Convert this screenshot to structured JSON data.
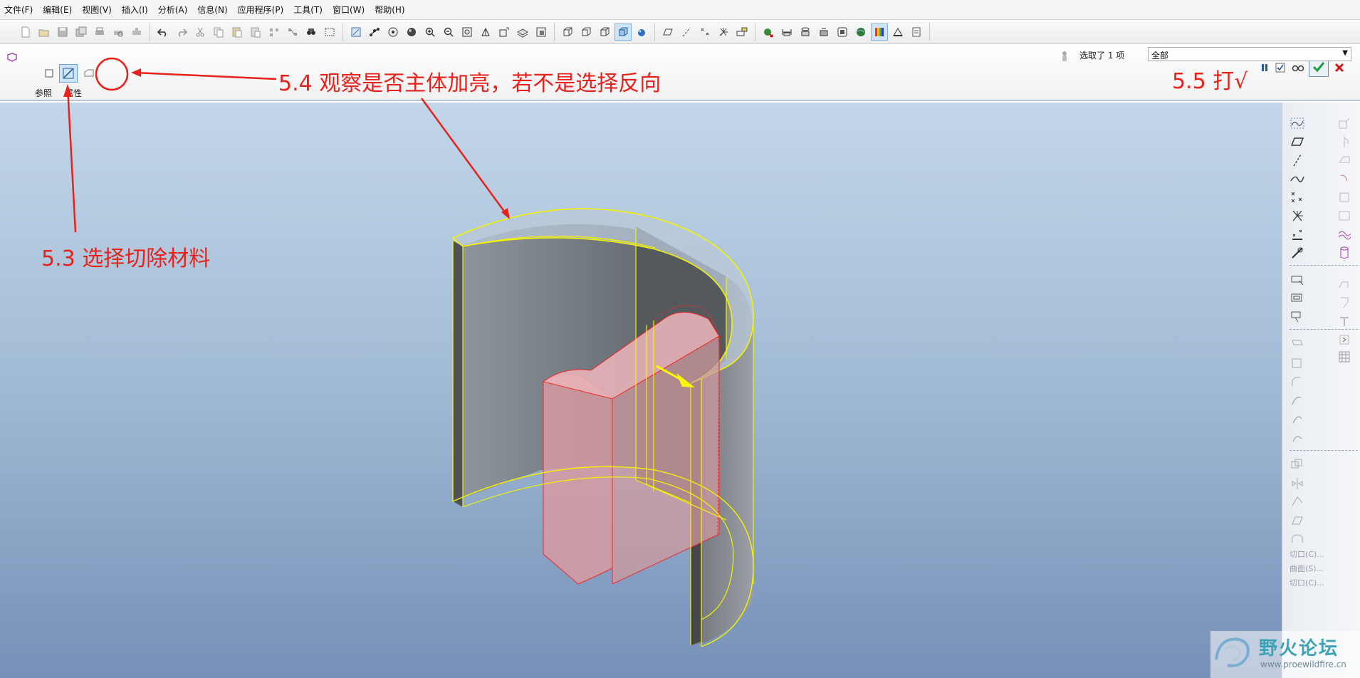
{
  "menu": [
    "文件(F)",
    "编辑(E)",
    "视图(V)",
    "插入(I)",
    "分析(A)",
    "信息(N)",
    "应用程序(P)",
    "工具(T)",
    "窗口(W)",
    "帮助(H)"
  ],
  "dashboard": {
    "tab_reference": "参照",
    "tab_properties": "属性",
    "select_status": "选取了 1 项",
    "filter_value": "全部"
  },
  "annotations": {
    "step_5_3": "5.3 选择切除材料",
    "step_5_4": "5.4 观察是否主体加亮，若不是选择反向",
    "step_5_5": "5.5 打√"
  },
  "right_panel": {
    "labels": [
      "切口(C)...",
      "曲面(S)...",
      "切口(C)..."
    ]
  },
  "watermark": {
    "text": "野火论坛",
    "url": "www.proewildfire.cn"
  },
  "colors": {
    "annotation_red": "#e8211b",
    "highlight_yellow": "#f2f200",
    "cut_preview_red": "#ee2a2a"
  }
}
